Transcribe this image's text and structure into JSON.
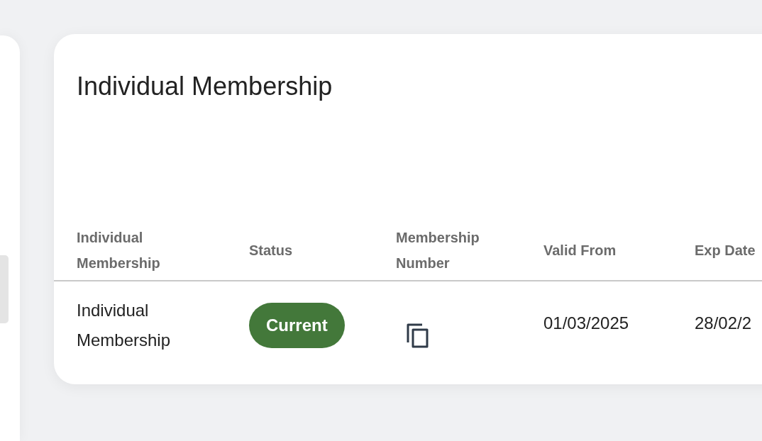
{
  "card": {
    "title": "Individual Membership",
    "table": {
      "columns": [
        "Individual Membership",
        "Status",
        "Membership Number",
        "Valid From",
        "Exp Date"
      ],
      "rows": [
        {
          "membership": "Individual Membership",
          "status": "Current",
          "membership_number_copy": true,
          "valid_from": "01/03/2025",
          "exp_date": "28/02/2"
        }
      ]
    }
  }
}
